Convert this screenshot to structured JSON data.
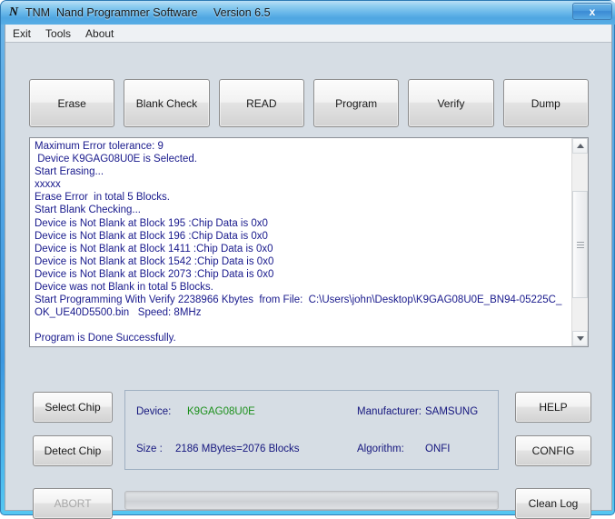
{
  "window": {
    "title": "TNM  Nand Programmer Software     Version 6.5",
    "logo_icon": "n-logo-icon",
    "close_label": "x",
    "frame_color": "#4fa3e3",
    "client_bg": "#d6dde4"
  },
  "menubar": {
    "items": [
      {
        "label": "Exit"
      },
      {
        "label": "Tools"
      },
      {
        "label": "About"
      }
    ]
  },
  "toolbar": {
    "buttons": [
      {
        "label": "Erase"
      },
      {
        "label": "Blank  Check"
      },
      {
        "label": "READ"
      },
      {
        "label": "Program"
      },
      {
        "label": "Verify"
      },
      {
        "label": "Dump"
      }
    ]
  },
  "log": {
    "text_color": "#18198c",
    "lines": [
      "Maximum Error tolerance: 9",
      " Device K9GAG08U0E is Selected.",
      "Start Erasing...",
      "xxxxx",
      "Erase Error  in total 5 Blocks.",
      "Start Blank Checking...",
      "Device is Not Blank at Block 195 :Chip Data is 0x0",
      "Device is Not Blank at Block 196 :Chip Data is 0x0",
      "Device is Not Blank at Block 1411 :Chip Data is 0x0",
      "Device is Not Blank at Block 1542 :Chip Data is 0x0",
      "Device is Not Blank at Block 2073 :Chip Data is 0x0",
      "Device was not Blank in total 5 Blocks.",
      "Start Programming With Verify 2238966 Kbytes  from File:  C:\\Users\\john\\Desktop\\K9GAG08U0E_BN94-05225C_OK_UE40D5500.bin   Speed: 8MHz",
      "",
      "Program is Done Successfully."
    ]
  },
  "scrollbar": {
    "up_icon": "triangle-up-icon",
    "down_icon": "triangle-down-icon",
    "grip_icon": "grip-lines-icon"
  },
  "left_buttons": {
    "select_chip": "Select Chip",
    "detect_chip": "Detect Chip",
    "abort": "ABORT",
    "abort_disabled": true
  },
  "right_buttons": {
    "help": "HELP",
    "config": "CONFIG",
    "clean_log": "Clean Log"
  },
  "info": {
    "device_label": "Device:",
    "device_value": "K9GAG08U0E",
    "device_value_color": "#1a8f1a",
    "manufacturer_label": "Manufacturer:",
    "manufacturer_value": "SAMSUNG",
    "size_label": "Size :",
    "size_value": "2186 MBytes=2076 Blocks",
    "algorithm_label": "Algorithm:",
    "algorithm_value": "ONFI"
  },
  "progress": {
    "percent": 0,
    "value_text": ""
  }
}
